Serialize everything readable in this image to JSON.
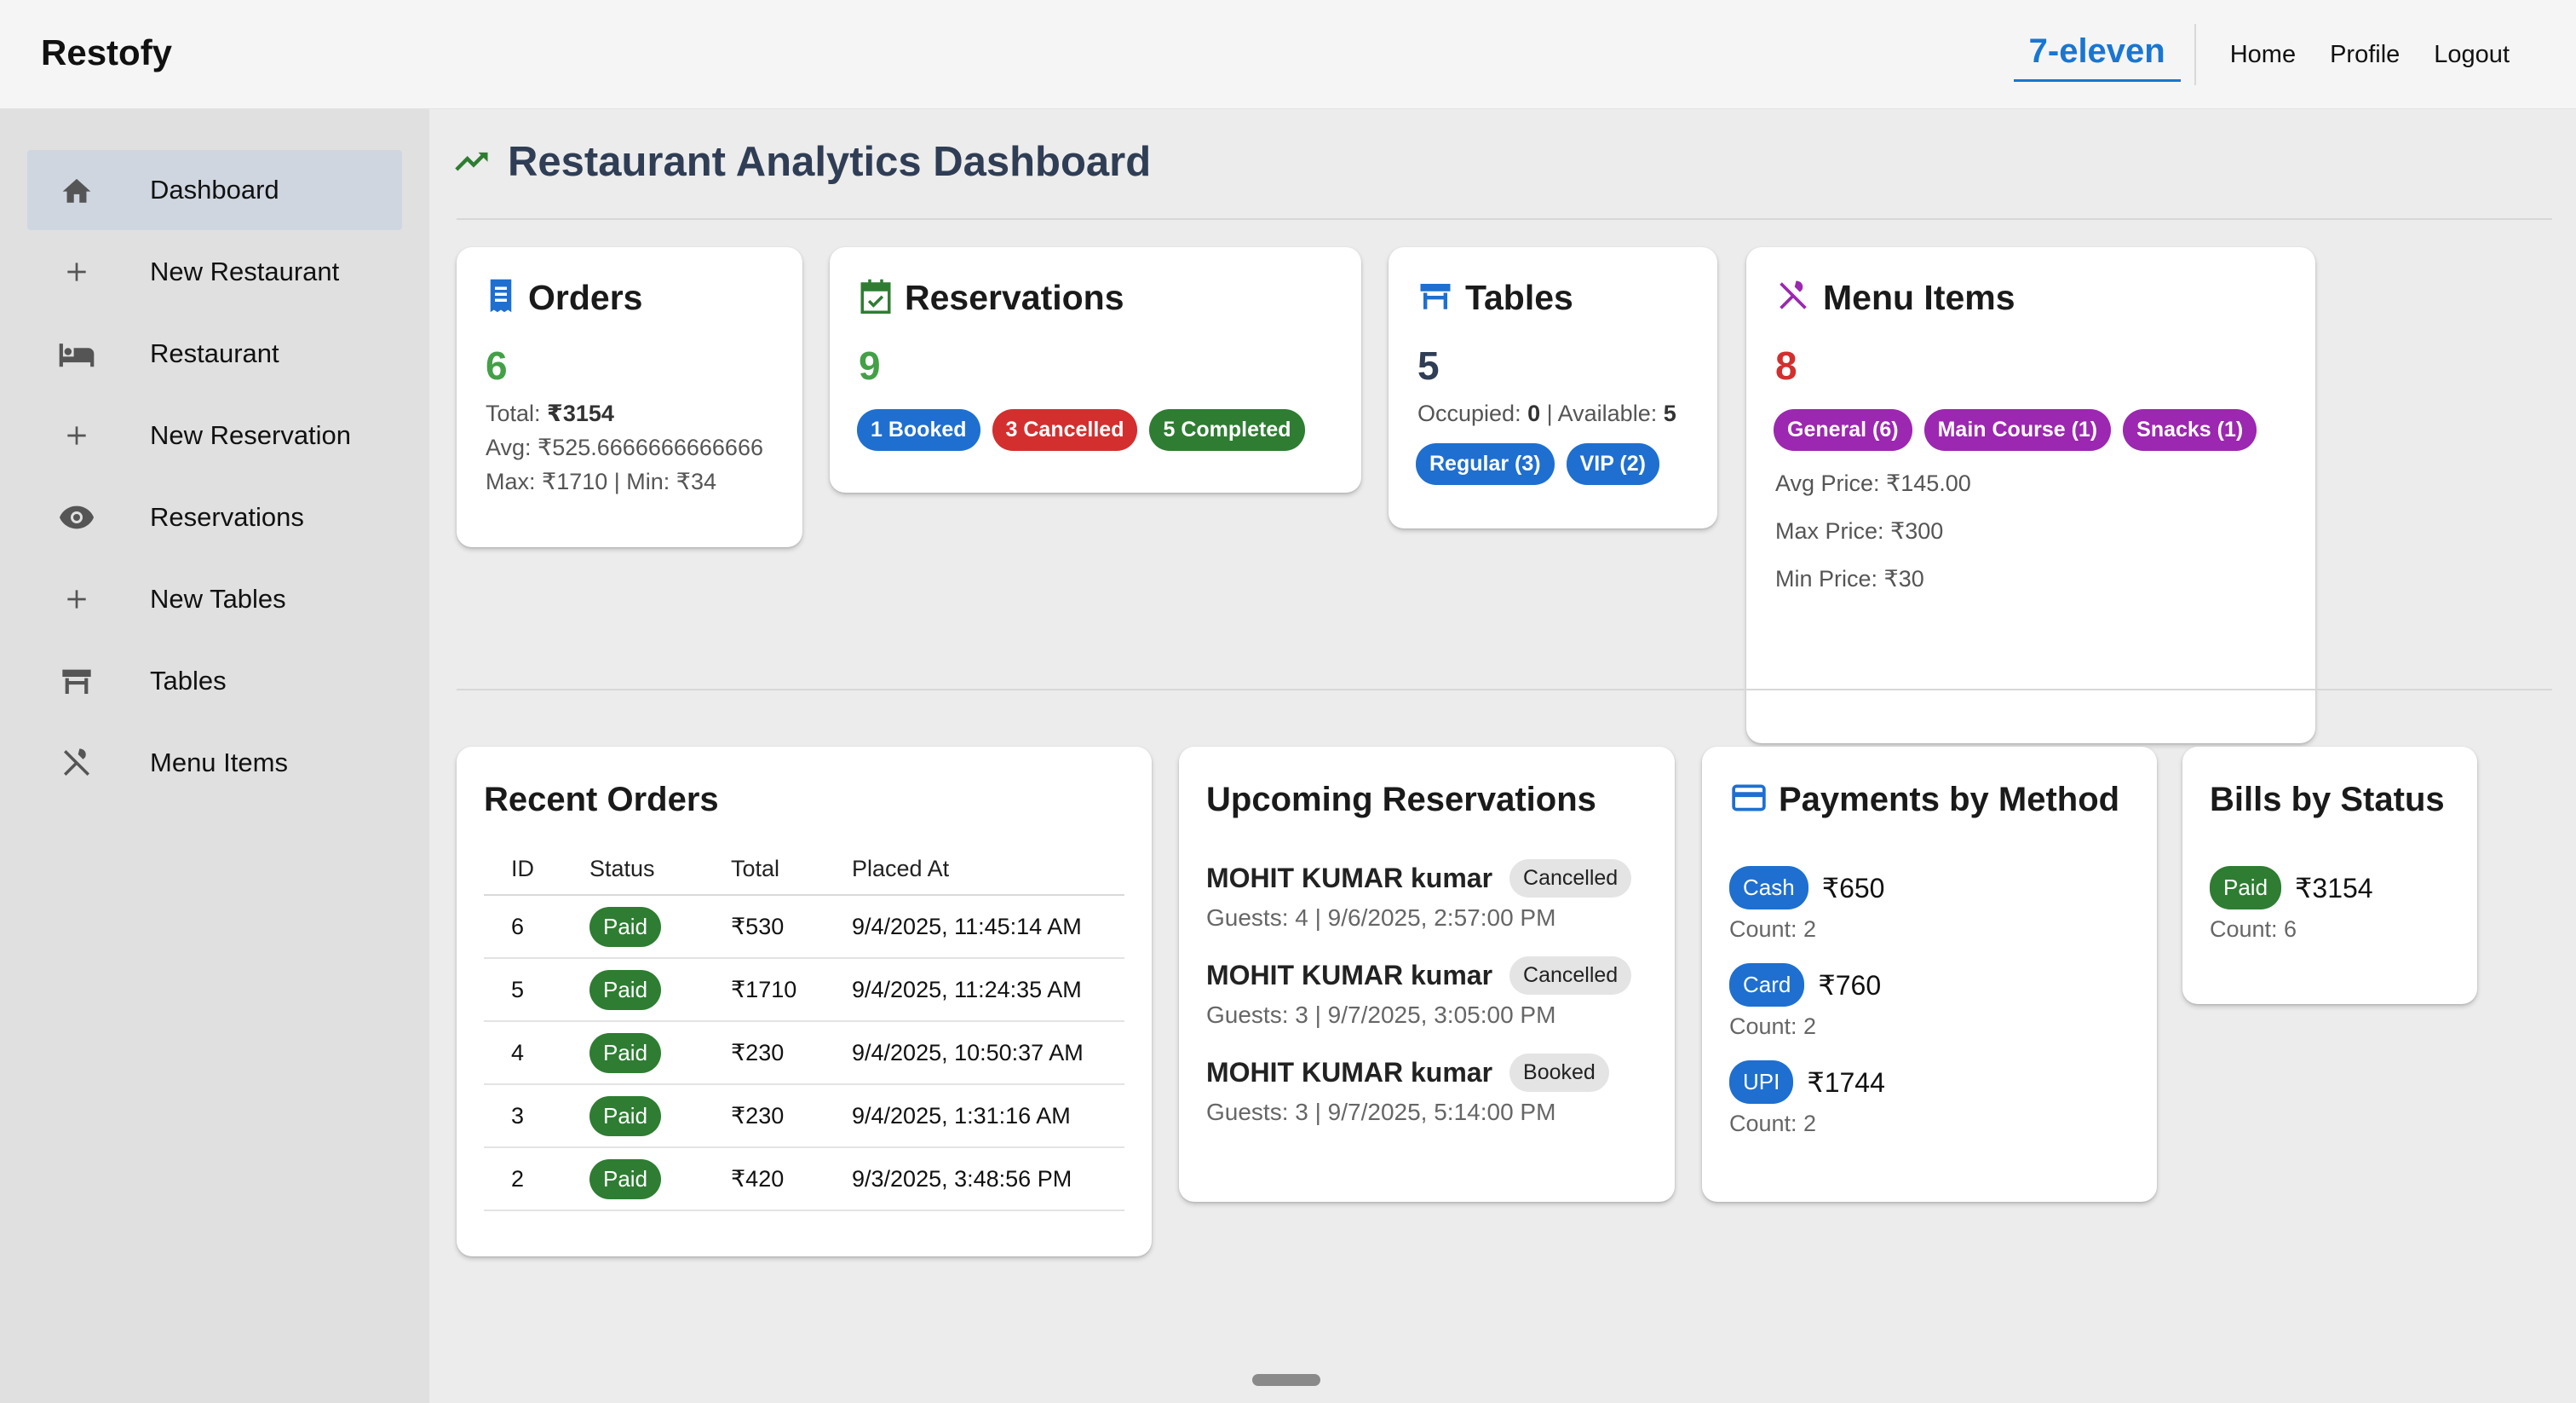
{
  "app": {
    "brand": "Restofy",
    "store": "7-eleven",
    "nav": [
      "Home",
      "Profile",
      "Logout"
    ]
  },
  "sidebar": {
    "items": [
      {
        "label": "Dashboard",
        "icon": "home-icon"
      },
      {
        "label": "New Restaurant",
        "icon": "plus-icon"
      },
      {
        "label": "Restaurant",
        "icon": "bed-icon"
      },
      {
        "label": "New Reservation",
        "icon": "plus-icon"
      },
      {
        "label": "Reservations",
        "icon": "eye-icon"
      },
      {
        "label": "New Tables",
        "icon": "plus-icon"
      },
      {
        "label": "Tables",
        "icon": "table-icon"
      },
      {
        "label": "Menu Items",
        "icon": "utensils-icon"
      }
    ]
  },
  "page": {
    "title": "Restaurant Analytics Dashboard"
  },
  "colors": {
    "primary": "#1976d2",
    "green": "#2e7d32",
    "red": "#d32f2f",
    "purple": "#9c27b0",
    "navy": "#2f3e55"
  },
  "orders": {
    "title": "Orders",
    "count": "6",
    "total_label": "Total: ",
    "total": "₹3154",
    "avg": "Avg: ₹525.6666666666666",
    "maxmin": "Max: ₹1710 | Min: ₹34"
  },
  "reservations": {
    "title": "Reservations",
    "count": "9",
    "pills": [
      "1 Booked",
      "3 Cancelled",
      "5 Completed"
    ]
  },
  "tables": {
    "title": "Tables",
    "count": "5",
    "occupied_label": "Occupied: ",
    "occupied": "0",
    "available_label": " | Available: ",
    "available": "5",
    "pills": [
      "Regular (3)",
      "VIP (2)"
    ]
  },
  "menu": {
    "title": "Menu Items",
    "count": "8",
    "pills": [
      "General (6)",
      "Main Course (1)",
      "Snacks (1)"
    ],
    "avg": "Avg Price: ₹145.00",
    "max": "Max Price: ₹300",
    "min": "Min Price: ₹30"
  },
  "recent_orders": {
    "title": "Recent Orders",
    "columns": [
      "ID",
      "Status",
      "Total",
      "Placed At"
    ],
    "rows": [
      {
        "id": "6",
        "status": "Paid",
        "total": "₹530",
        "placed": "9/4/2025, 11:45:14 AM"
      },
      {
        "id": "5",
        "status": "Paid",
        "total": "₹1710",
        "placed": "9/4/2025, 11:24:35 AM"
      },
      {
        "id": "4",
        "status": "Paid",
        "total": "₹230",
        "placed": "9/4/2025, 10:50:37 AM"
      },
      {
        "id": "3",
        "status": "Paid",
        "total": "₹230",
        "placed": "9/4/2025, 1:31:16 AM"
      },
      {
        "id": "2",
        "status": "Paid",
        "total": "₹420",
        "placed": "9/3/2025, 3:48:56 PM"
      }
    ]
  },
  "upcoming": {
    "title": "Upcoming Reservations",
    "items": [
      {
        "name": "MOHIT KUMAR kumar",
        "status": "Cancelled",
        "details": "Guests: 4 | 9/6/2025, 2:57:00 PM"
      },
      {
        "name": "MOHIT KUMAR kumar",
        "status": "Cancelled",
        "details": "Guests: 3 | 9/7/2025, 3:05:00 PM"
      },
      {
        "name": "MOHIT KUMAR kumar",
        "status": "Booked",
        "details": "Guests: 3 | 9/7/2025, 5:14:00 PM"
      }
    ]
  },
  "payments": {
    "title": "Payments by Method",
    "items": [
      {
        "method": "Cash",
        "amount": "₹650",
        "count": "Count: 2"
      },
      {
        "method": "Card",
        "amount": "₹760",
        "count": "Count: 2"
      },
      {
        "method": "UPI",
        "amount": "₹1744",
        "count": "Count: 2"
      }
    ]
  },
  "bills": {
    "title": "Bills by Status",
    "status": "Paid",
    "amount": "₹3154",
    "count": "Count: 6"
  }
}
